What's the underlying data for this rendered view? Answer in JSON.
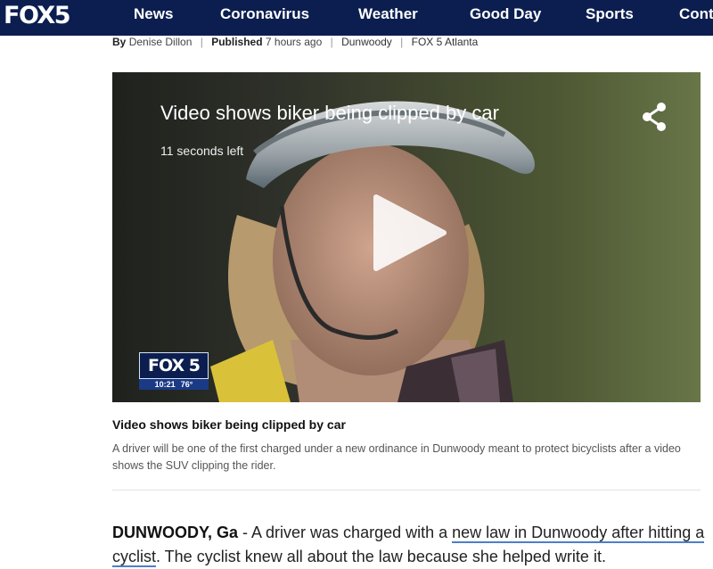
{
  "header": {
    "logo": "FOX5",
    "nav": [
      "News",
      "Coronavirus",
      "Weather",
      "Good Day",
      "Sports",
      "Cont"
    ]
  },
  "byline": {
    "by_label": "By",
    "author": "Denise Dillon",
    "published_label": "Published",
    "published_time": "7 hours ago",
    "tag": "Dunwoody",
    "source": "FOX 5 Atlanta"
  },
  "video": {
    "title": "Video shows biker being clipped by car",
    "time_left": "11 seconds left",
    "bug_logo": "FOX 5",
    "bug_time": "10:21",
    "bug_temp": "76°",
    "icons": {
      "share": "share-icon",
      "play": "play-icon"
    }
  },
  "caption": {
    "title": "Video shows biker being clipped by car",
    "text": "A driver will be one of the first charged under a new ordinance in Dunwoody meant to protect bicyclists after a video shows the SUV clipping the rider."
  },
  "article": {
    "dateline": "DUNWOODY, Ga",
    "text_before": " - A driver was charged with a ",
    "link_text": "new law in Dunwoody after hitting a cyclist",
    "text_after": ".  The cyclist knew all about the law because she helped write it."
  },
  "colors": {
    "nav_bg": "#0b1e4f",
    "link_underline": "#4d7fc9"
  }
}
